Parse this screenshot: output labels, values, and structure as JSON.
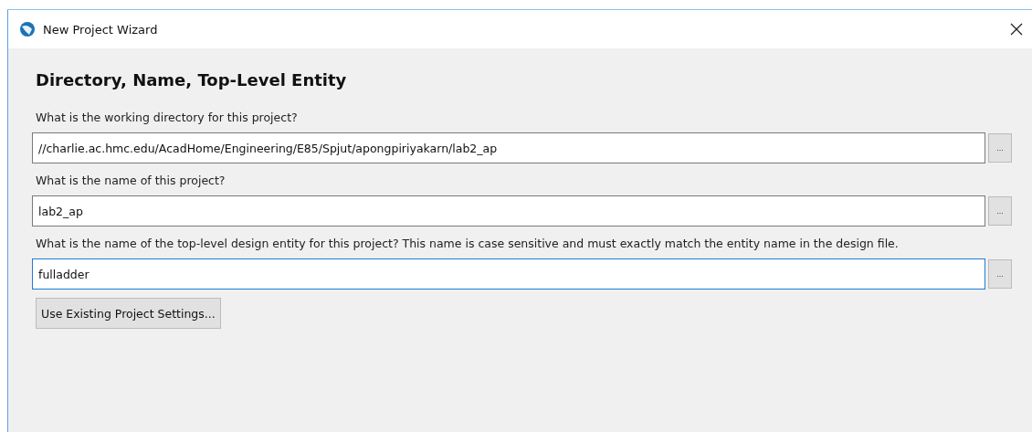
{
  "window": {
    "title": "New Project Wizard"
  },
  "heading": "Directory, Name, Top-Level Entity",
  "fields": [
    {
      "label": "What is the working directory for this project?",
      "value": "//charlie.ac.hmc.edu/AcadHome/Engineering/E85/Spjut/apongpiriyakarn/lab2_ap",
      "focused": false,
      "browse": "..."
    },
    {
      "label": "What is the name of this project?",
      "value": "lab2_ap",
      "focused": false,
      "browse": "..."
    },
    {
      "label": "What is the name of the top-level design entity for this project? This name is case sensitive and must exactly match the entity name in the design file.",
      "value": "fulladder",
      "focused": true,
      "browse": "..."
    }
  ],
  "button": "Use Existing Project Settings..."
}
